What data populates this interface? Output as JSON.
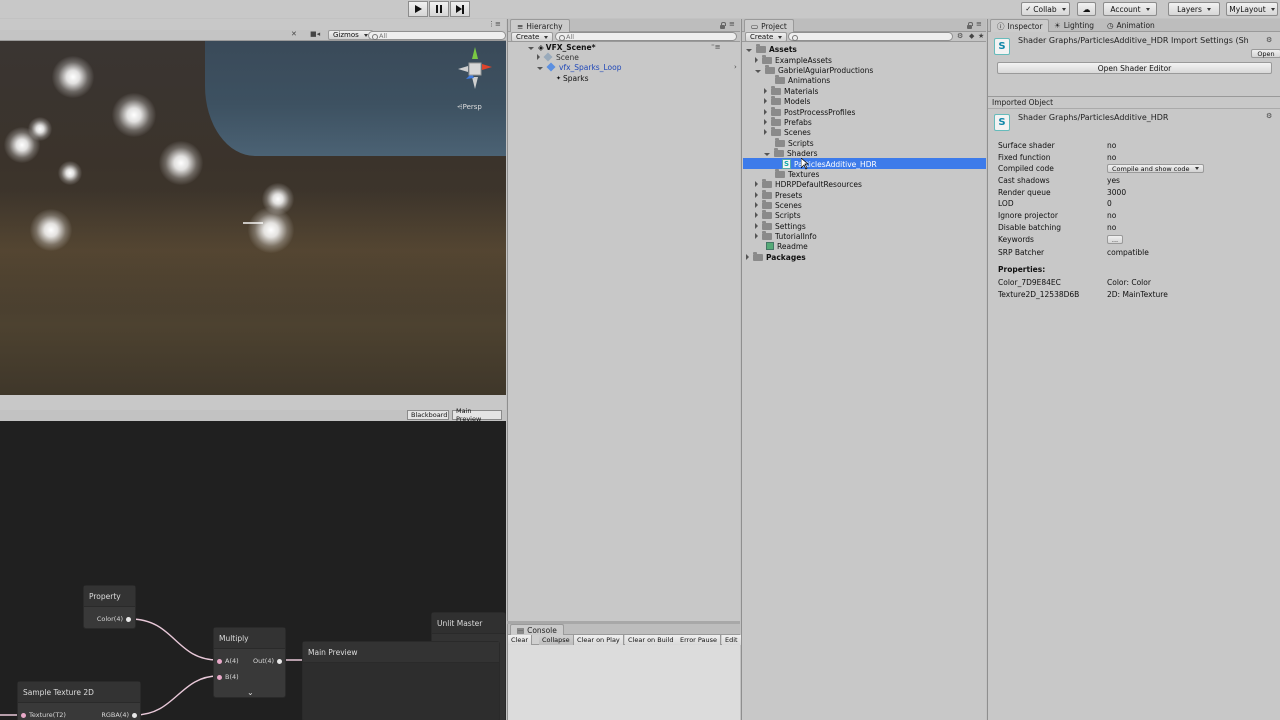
{
  "toolbar": {
    "collab": "Collab",
    "account": "Account",
    "layers": "Layers",
    "layout": "MyLayout"
  },
  "scene_view": {
    "gizmos": "Gizmos",
    "search_placeholder": "All",
    "persp_label": "Persp"
  },
  "graph_view": {
    "tabs": [
      "Blackboard",
      "Main Preview"
    ],
    "nodes": {
      "property": {
        "title": "Property",
        "out": "Color(4)"
      },
      "multiply": {
        "title": "Multiply",
        "in_a": "A(4)",
        "in_b": "B(4)",
        "out": "Out(4)"
      },
      "sample_texture": {
        "title": "Sample Texture 2D",
        "in_texture": "Texture(T2)",
        "out_rgba": "RGBA(4)"
      },
      "unlit_master": {
        "title": "Unlit Master"
      },
      "main_preview": {
        "title": "Main Preview"
      }
    }
  },
  "hierarchy": {
    "tab": "Hierarchy",
    "create": "Create",
    "search_placeholder": "All",
    "scene_name": "VFX_Scene*",
    "items": [
      "Scene",
      "vfx_Sparks_Loop",
      "Sparks"
    ]
  },
  "console": {
    "tab": "Console",
    "buttons": [
      "Clear",
      "Collapse",
      "Clear on Play",
      "Clear on Build",
      "Error Pause",
      "Edit"
    ]
  },
  "project": {
    "tab": "Project",
    "create": "Create",
    "tree": {
      "assets": "Assets",
      "example_assets": "ExampleAssets",
      "gabriel": "GabrielAguiarProductions",
      "animations": "Animations",
      "materials": "Materials",
      "models": "Models",
      "post": "PostProcessProfiles",
      "prefabs": "Prefabs",
      "scenes_sub": "Scenes",
      "scripts_sub": "Scripts",
      "shaders": "Shaders",
      "selected_file": "ParticlesAdditive_HDR",
      "textures": "Textures",
      "hdrp": "HDRPDefaultResources",
      "presets": "Presets",
      "scenes": "Scenes",
      "scripts": "Scripts",
      "settings": "Settings",
      "tutorial": "TutorialInfo",
      "readme": "Readme",
      "packages": "Packages"
    }
  },
  "inspector": {
    "tabs": [
      "Inspector",
      "Lighting",
      "Animation"
    ],
    "header_title": "Shader Graphs/ParticlesAdditive_HDR Import Settings (Sh",
    "open_label": "Open",
    "open_editor": "Open Shader Editor",
    "imported_object": "Imported Object",
    "object_name": "Shader Graphs/ParticlesAdditive_HDR",
    "props": [
      {
        "label": "Surface shader",
        "value": "no"
      },
      {
        "label": "Fixed function",
        "value": "no"
      },
      {
        "label": "Compiled code",
        "value": "Compile and show code"
      },
      {
        "label": "Cast shadows",
        "value": "yes"
      },
      {
        "label": "Render queue",
        "value": "3000"
      },
      {
        "label": "LOD",
        "value": "0"
      },
      {
        "label": "Ignore projector",
        "value": "no"
      },
      {
        "label": "Disable batching",
        "value": "no"
      },
      {
        "label": "Keywords",
        "value": "..."
      },
      {
        "label": "SRP Batcher",
        "value": "compatible"
      }
    ],
    "properties_title": "Properties:",
    "properties": [
      {
        "name": "Color_7D9E84EC",
        "value": "Color: Color"
      },
      {
        "name": "Texture2D_12538D6B",
        "value": "2D: MainTexture"
      }
    ]
  }
}
